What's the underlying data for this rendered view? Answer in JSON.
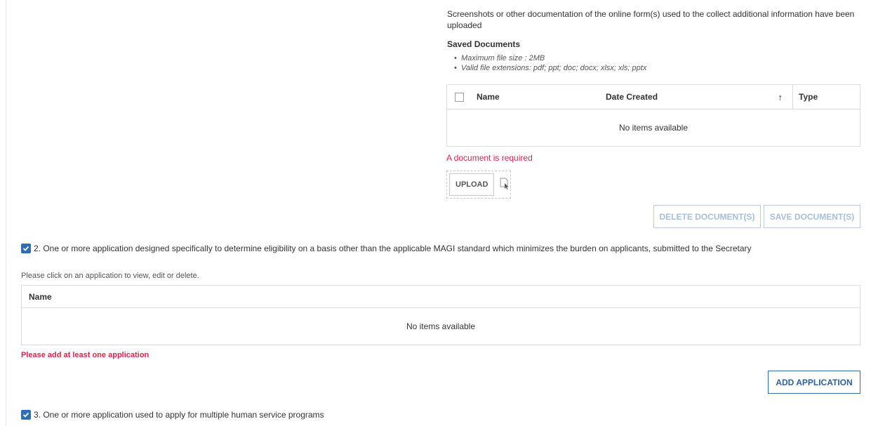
{
  "documents": {
    "description": "Screenshots or other documentation of the online form(s) used to the collect additional information have been uploaded",
    "saved_title": "Saved Documents",
    "hints": [
      "Maximum file size : 2MB",
      "Valid file extensions: pdf; ppt; doc; docx; xlsx; xls; pptx"
    ],
    "grid": {
      "columns": [
        "Name",
        "Date Created",
        "Type"
      ],
      "sort_icon": "arrow-up-icon",
      "empty_text": "No items available"
    },
    "error": "A document is required",
    "upload_label": "UPLOAD",
    "upload_icon": "file-cursor-icon",
    "delete_label": "DELETE DOCUMENT(S)",
    "save_label": "SAVE DOCUMENT(S)"
  },
  "item2": {
    "checked": true,
    "label": "2. One or more application designed specifically to determine eligibility on a basis other than the applicable MAGI standard which minimizes the burden on applicants, submitted to the Secretary",
    "hint": "Please click on an application to view, edit or delete.",
    "grid": {
      "columns": [
        "Name"
      ],
      "empty_text": "No items available"
    },
    "error": "Please add at least one application",
    "add_label": "ADD APPLICATION"
  },
  "item3": {
    "checked": true,
    "label": "3. One or more application used to apply for multiple human service programs"
  },
  "colors": {
    "accent": "#2f6db4",
    "error": "#e0234e",
    "disabled": "#a7bfdc"
  }
}
